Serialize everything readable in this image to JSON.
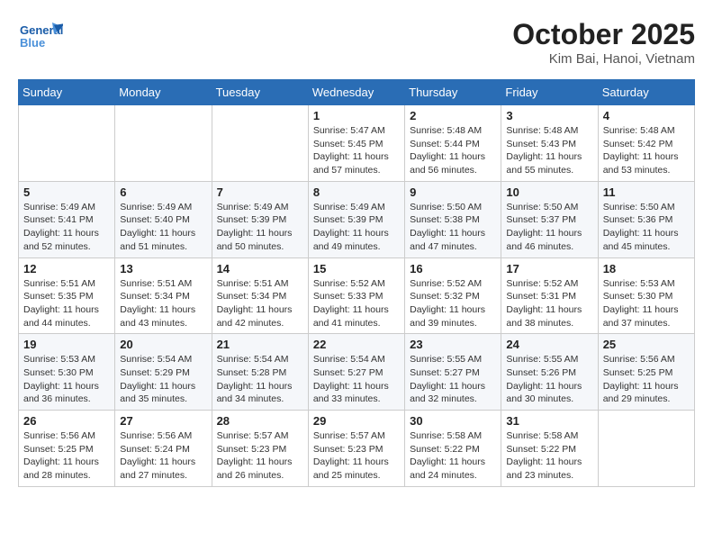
{
  "brand": {
    "name_part1": "General",
    "name_part2": "Blue"
  },
  "header": {
    "month_year": "October 2025",
    "location": "Kim Bai, Hanoi, Vietnam"
  },
  "weekdays": [
    "Sunday",
    "Monday",
    "Tuesday",
    "Wednesday",
    "Thursday",
    "Friday",
    "Saturday"
  ],
  "weeks": [
    [
      {
        "day": "",
        "info": ""
      },
      {
        "day": "",
        "info": ""
      },
      {
        "day": "",
        "info": ""
      },
      {
        "day": "1",
        "info": "Sunrise: 5:47 AM\nSunset: 5:45 PM\nDaylight: 11 hours and 57 minutes."
      },
      {
        "day": "2",
        "info": "Sunrise: 5:48 AM\nSunset: 5:44 PM\nDaylight: 11 hours and 56 minutes."
      },
      {
        "day": "3",
        "info": "Sunrise: 5:48 AM\nSunset: 5:43 PM\nDaylight: 11 hours and 55 minutes."
      },
      {
        "day": "4",
        "info": "Sunrise: 5:48 AM\nSunset: 5:42 PM\nDaylight: 11 hours and 53 minutes."
      }
    ],
    [
      {
        "day": "5",
        "info": "Sunrise: 5:49 AM\nSunset: 5:41 PM\nDaylight: 11 hours and 52 minutes."
      },
      {
        "day": "6",
        "info": "Sunrise: 5:49 AM\nSunset: 5:40 PM\nDaylight: 11 hours and 51 minutes."
      },
      {
        "day": "7",
        "info": "Sunrise: 5:49 AM\nSunset: 5:39 PM\nDaylight: 11 hours and 50 minutes."
      },
      {
        "day": "8",
        "info": "Sunrise: 5:49 AM\nSunset: 5:39 PM\nDaylight: 11 hours and 49 minutes."
      },
      {
        "day": "9",
        "info": "Sunrise: 5:50 AM\nSunset: 5:38 PM\nDaylight: 11 hours and 47 minutes."
      },
      {
        "day": "10",
        "info": "Sunrise: 5:50 AM\nSunset: 5:37 PM\nDaylight: 11 hours and 46 minutes."
      },
      {
        "day": "11",
        "info": "Sunrise: 5:50 AM\nSunset: 5:36 PM\nDaylight: 11 hours and 45 minutes."
      }
    ],
    [
      {
        "day": "12",
        "info": "Sunrise: 5:51 AM\nSunset: 5:35 PM\nDaylight: 11 hours and 44 minutes."
      },
      {
        "day": "13",
        "info": "Sunrise: 5:51 AM\nSunset: 5:34 PM\nDaylight: 11 hours and 43 minutes."
      },
      {
        "day": "14",
        "info": "Sunrise: 5:51 AM\nSunset: 5:34 PM\nDaylight: 11 hours and 42 minutes."
      },
      {
        "day": "15",
        "info": "Sunrise: 5:52 AM\nSunset: 5:33 PM\nDaylight: 11 hours and 41 minutes."
      },
      {
        "day": "16",
        "info": "Sunrise: 5:52 AM\nSunset: 5:32 PM\nDaylight: 11 hours and 39 minutes."
      },
      {
        "day": "17",
        "info": "Sunrise: 5:52 AM\nSunset: 5:31 PM\nDaylight: 11 hours and 38 minutes."
      },
      {
        "day": "18",
        "info": "Sunrise: 5:53 AM\nSunset: 5:30 PM\nDaylight: 11 hours and 37 minutes."
      }
    ],
    [
      {
        "day": "19",
        "info": "Sunrise: 5:53 AM\nSunset: 5:30 PM\nDaylight: 11 hours and 36 minutes."
      },
      {
        "day": "20",
        "info": "Sunrise: 5:54 AM\nSunset: 5:29 PM\nDaylight: 11 hours and 35 minutes."
      },
      {
        "day": "21",
        "info": "Sunrise: 5:54 AM\nSunset: 5:28 PM\nDaylight: 11 hours and 34 minutes."
      },
      {
        "day": "22",
        "info": "Sunrise: 5:54 AM\nSunset: 5:27 PM\nDaylight: 11 hours and 33 minutes."
      },
      {
        "day": "23",
        "info": "Sunrise: 5:55 AM\nSunset: 5:27 PM\nDaylight: 11 hours and 32 minutes."
      },
      {
        "day": "24",
        "info": "Sunrise: 5:55 AM\nSunset: 5:26 PM\nDaylight: 11 hours and 30 minutes."
      },
      {
        "day": "25",
        "info": "Sunrise: 5:56 AM\nSunset: 5:25 PM\nDaylight: 11 hours and 29 minutes."
      }
    ],
    [
      {
        "day": "26",
        "info": "Sunrise: 5:56 AM\nSunset: 5:25 PM\nDaylight: 11 hours and 28 minutes."
      },
      {
        "day": "27",
        "info": "Sunrise: 5:56 AM\nSunset: 5:24 PM\nDaylight: 11 hours and 27 minutes."
      },
      {
        "day": "28",
        "info": "Sunrise: 5:57 AM\nSunset: 5:23 PM\nDaylight: 11 hours and 26 minutes."
      },
      {
        "day": "29",
        "info": "Sunrise: 5:57 AM\nSunset: 5:23 PM\nDaylight: 11 hours and 25 minutes."
      },
      {
        "day": "30",
        "info": "Sunrise: 5:58 AM\nSunset: 5:22 PM\nDaylight: 11 hours and 24 minutes."
      },
      {
        "day": "31",
        "info": "Sunrise: 5:58 AM\nSunset: 5:22 PM\nDaylight: 11 hours and 23 minutes."
      },
      {
        "day": "",
        "info": ""
      }
    ]
  ]
}
